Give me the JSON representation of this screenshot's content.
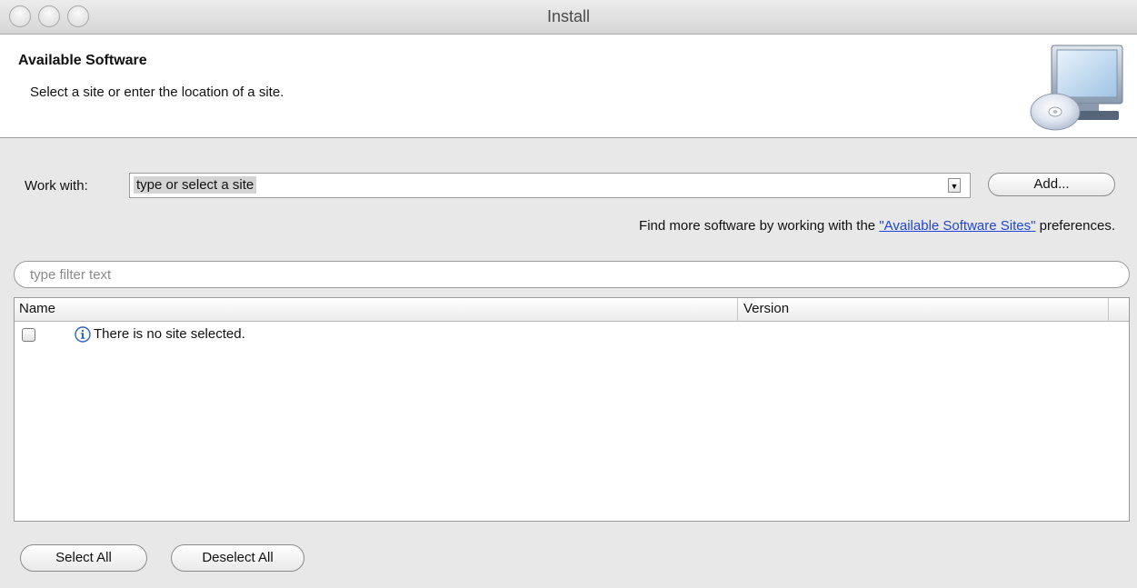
{
  "window": {
    "title": "Install"
  },
  "banner": {
    "title": "Available Software",
    "description": "Select a site or enter the location of a site.",
    "icon": "install-software-icon"
  },
  "work_with": {
    "label": "Work with:",
    "value": "type or select a site",
    "add_button": "Add..."
  },
  "find_more": {
    "prefix": "Find more software by working with the ",
    "link": "\"Available Software Sites\"",
    "suffix": " preferences."
  },
  "filter": {
    "placeholder": "type filter text"
  },
  "table": {
    "columns": [
      "Name",
      "Version"
    ],
    "rows": [
      {
        "checked": false,
        "icon": "info-icon",
        "name": "There is no site selected.",
        "version": ""
      }
    ]
  },
  "buttons": {
    "select_all": "Select All",
    "deselect_all": "Deselect All"
  }
}
